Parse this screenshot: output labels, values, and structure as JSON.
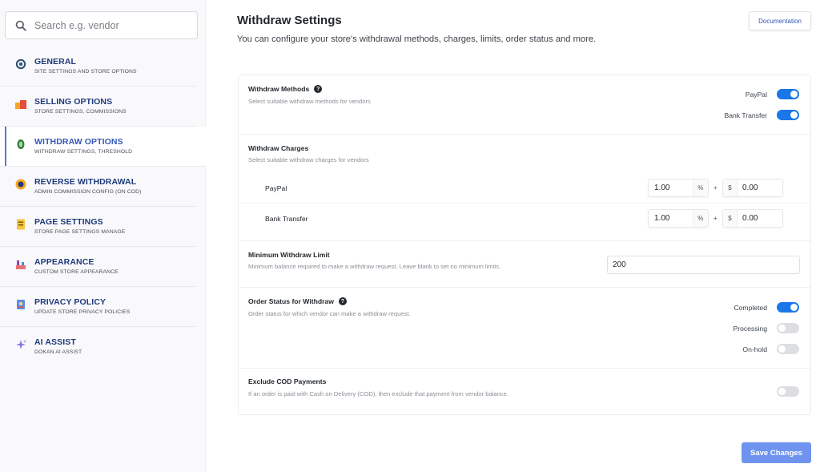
{
  "search": {
    "placeholder": "Search e.g. vendor"
  },
  "sidebar": {
    "items": [
      {
        "title": "GENERAL",
        "subtitle": "SITE SETTINGS AND STORE OPTIONS",
        "icon": "gear-icon"
      },
      {
        "title": "SELLING OPTIONS",
        "subtitle": "STORE SETTINGS, COMMISSIONS",
        "icon": "store-icon"
      },
      {
        "title": "WITHDRAW OPTIONS",
        "subtitle": "WITHDRAW SETTINGS, THRESHOLD",
        "icon": "wallet-icon"
      },
      {
        "title": "REVERSE WITHDRAWAL",
        "subtitle": "ADMIN COMMISSION CONFIG (ON COD)",
        "icon": "coin-icon"
      },
      {
        "title": "PAGE SETTINGS",
        "subtitle": "STORE PAGE SETTINGS MANAGE",
        "icon": "page-icon"
      },
      {
        "title": "APPEARANCE",
        "subtitle": "CUSTOM STORE APPEARANCE",
        "icon": "palette-icon"
      },
      {
        "title": "PRIVACY POLICY",
        "subtitle": "UPDATE STORE PRIVACY POLICIES",
        "icon": "privacy-icon"
      },
      {
        "title": "AI ASSIST",
        "subtitle": "DOKAN AI ASSIST",
        "icon": "sparkle-icon"
      }
    ],
    "active_index": 2
  },
  "header": {
    "title": "Withdraw Settings",
    "description": "You can configure your store's withdrawal methods, charges, limits, order status and more.",
    "doc_label": "Documentation"
  },
  "withdraw_methods": {
    "title": "Withdraw Methods",
    "description": "Select suitable withdraw methods for vendors",
    "options": [
      {
        "label": "PayPal",
        "enabled": true
      },
      {
        "label": "Bank Transfer",
        "enabled": true
      }
    ]
  },
  "withdraw_charges": {
    "title": "Withdraw Charges",
    "description": "Select suitable withdraw charges for vendors",
    "rows": [
      {
        "label": "PayPal",
        "percent": "1.00",
        "percent_unit": "%",
        "plus": "+",
        "fixed_unit": "$",
        "fixed": "0.00"
      },
      {
        "label": "Bank Transfer",
        "percent": "1.00",
        "percent_unit": "%",
        "plus": "+",
        "fixed_unit": "$",
        "fixed": "0.00"
      }
    ]
  },
  "min_limit": {
    "title": "Minimum Withdraw Limit",
    "description": "Minimum balance required to make a withdraw request. Leave blank to set no minimum limits.",
    "value": "200"
  },
  "order_status": {
    "title": "Order Status for Withdraw",
    "description": "Order status for which vendor can make a withdraw request.",
    "options": [
      {
        "label": "Completed",
        "enabled": true
      },
      {
        "label": "Processing",
        "enabled": false
      },
      {
        "label": "On-hold",
        "enabled": false
      }
    ]
  },
  "exclude_cod": {
    "title": "Exclude COD Payments",
    "description": "If an order is paid with Cash on Delivery (COD), then exclude that payment from vendor balance.",
    "enabled": false
  },
  "footer": {
    "save_label": "Save Changes"
  },
  "colors": {
    "accent": "#1a77e8",
    "nav_title": "#1f3a7a",
    "save_button": "#6f94f0"
  }
}
